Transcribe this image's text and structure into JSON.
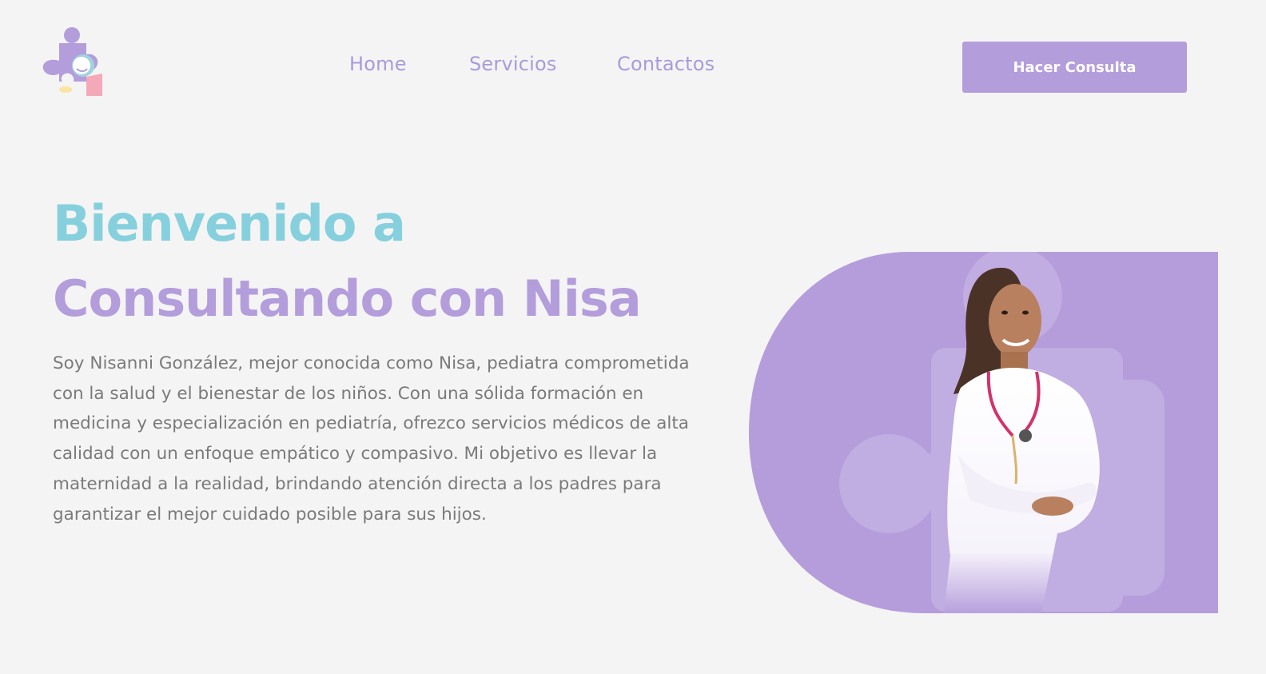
{
  "header": {
    "nav": [
      {
        "label": "Home"
      },
      {
        "label": "Servicios"
      },
      {
        "label": "Contactos"
      }
    ],
    "cta_label": "Hacer Consulta"
  },
  "hero": {
    "title_line1": "Bienvenido a",
    "title_line2": "Consultando con Nisa",
    "description": "Soy Nisanni González, mejor conocida como Nisa, pediatra comprometida con la salud y el bienestar de los niños. Con una sólida formación en medicina y especialización en pediatría, ofrezco servicios médicos de alta calidad con un enfoque empático y compasivo. Mi objetivo es llevar la maternidad a la realidad, brindando atención directa a los padres para garantizar el mejor cuidado posible para sus hijos."
  },
  "colors": {
    "background": "#f4f4f4",
    "brand_purple": "#b39ddb",
    "nav_purple": "#a99bd9",
    "brand_teal": "#86d0dd",
    "text_gray": "#7a7a7a",
    "logo_pink": "#f4a9b8",
    "logo_yellow": "#fbe3a1"
  },
  "icons": {
    "logo": "puzzle-mother-baby-logo",
    "hero_background": "puzzle-piece-shape"
  }
}
